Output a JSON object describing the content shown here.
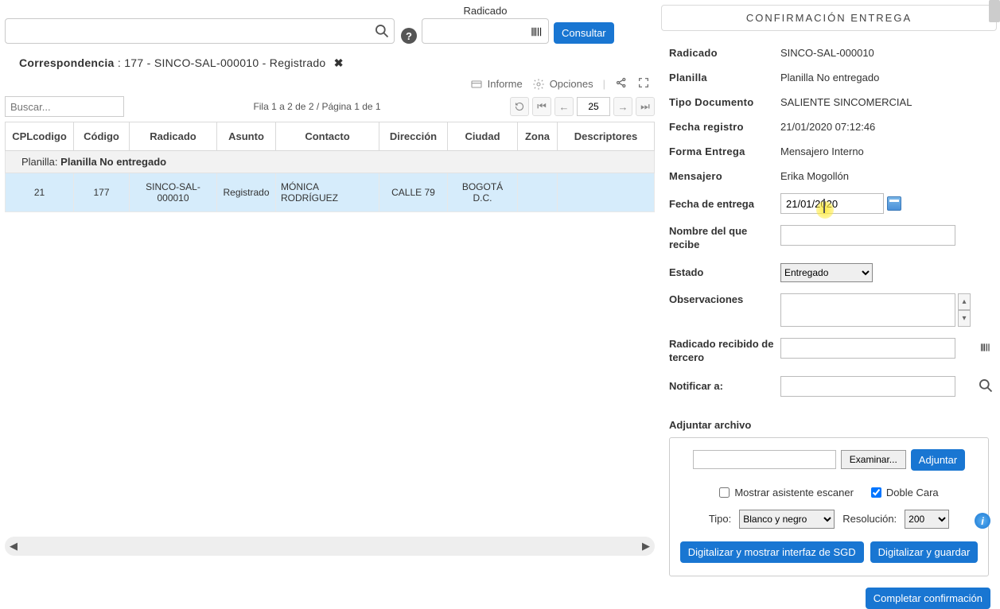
{
  "search": {
    "radicado_label": "Radicado",
    "consultar_btn": "Consultar"
  },
  "breadcrumb": {
    "prefix": "Correspondencia",
    "value": ": 177 - SINCO-SAL-000010 - Registrado"
  },
  "toolbar": {
    "informe": "Informe",
    "opciones": "Opciones"
  },
  "gridbar": {
    "buscar_placeholder": "Buscar...",
    "pageinfo": "Fila 1 a 2 de 2 / Página 1 de 1",
    "pagesize": "25"
  },
  "columns": [
    "CPLcodigo",
    "Código",
    "Radicado",
    "Asunto",
    "Contacto",
    "Dirección",
    "Ciudad",
    "Zona",
    "Descriptores"
  ],
  "group": {
    "label": "Planilla:",
    "value": "Planilla No entregado"
  },
  "row": {
    "cpl": "21",
    "codigo": "177",
    "radicado": "SINCO-SAL-000010",
    "asunto": "Registrado",
    "contacto": "MÓNICA RODRÍGUEZ",
    "direccion": "CALLE 79",
    "ciudad": "BOGOTÁ D.C.",
    "zona": "",
    "descriptores": ""
  },
  "panel": {
    "title": "CONFIRMACIÓN ENTREGA",
    "info": {
      "Radicado": "SINCO-SAL-000010",
      "Planilla": "Planilla No entregado",
      "Tipo Documento": "SALIENTE SINCOMERCIAL",
      "Fecha registro": "21/01/2020 07:12:46",
      "Forma Entrega": "Mensajero Interno",
      "Mensajero": "Erika Mogollón"
    },
    "labels": {
      "fecha_entrega": "Fecha de entrega",
      "nombre_recibe": "Nombre del que recibe",
      "estado": "Estado",
      "observaciones": "Observaciones",
      "rad_tercero": "Radicado recibido de tercero",
      "notificar": "Notificar a:"
    },
    "fecha_entrega_value": "21/01/2020",
    "estado_value": "Entregado",
    "attach_header": "Adjuntar archivo",
    "browse": "Examinar...",
    "adjuntar": "Adjuntar",
    "cb_asistente": "Mostrar asistente escaner",
    "cb_doble": "Doble Cara",
    "tipo_label": "Tipo:",
    "tipo_value": "Blanco y negro",
    "res_label": "Resolución:",
    "res_value": "200",
    "btn_dig_sgd": "Digitalizar y mostrar interfaz de SGD",
    "btn_dig_save": "Digitalizar y guardar",
    "btn_complete": "Completar confirmación"
  }
}
